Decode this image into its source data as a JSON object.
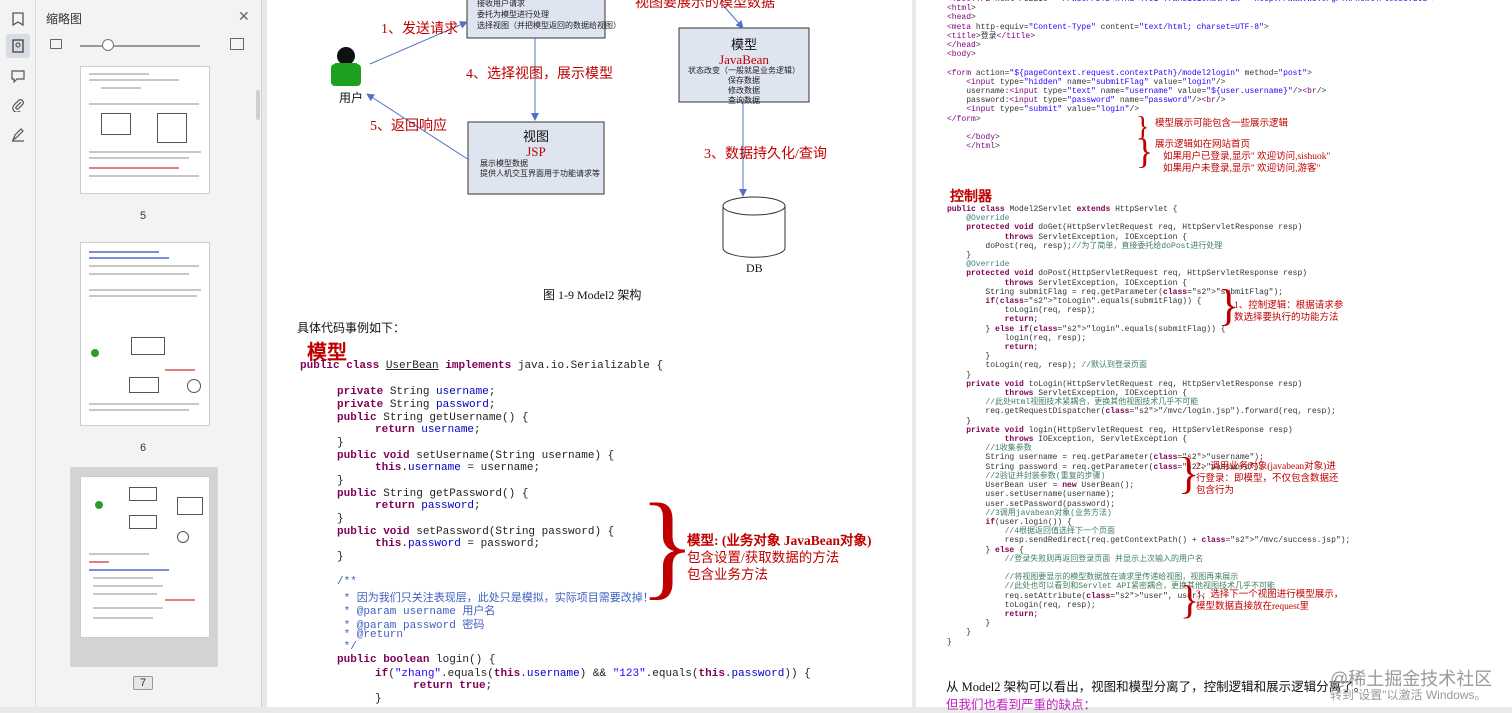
{
  "sidebar": {
    "title": "缩略图",
    "tools": [
      "bookmark-icon",
      "thumbnail-icon",
      "comment-icon",
      "attachment-icon",
      "signature-icon"
    ],
    "pages": [
      "5",
      "6",
      "7"
    ],
    "selected_page": "7"
  },
  "page1": {
    "diagram": {
      "step1": "1、发送请求",
      "step2_text": "视图要展示的模型数据",
      "step3": "3、数据持久化/查询",
      "step4": "4、选择视图，展示模型",
      "step5": "5、返回响应",
      "user_label": "用户",
      "controller_lines": [
        "接收用户请求",
        "委托为模型进行处理",
        "选择视图（并把模型返回的数据给视图）"
      ],
      "model_title": "模型",
      "model_sub": "JavaBean",
      "model_lines": [
        "状态改变（一般就是业务逻辑）",
        "保存数据",
        "修改数据",
        "查询数据"
      ],
      "view_title": "视图",
      "view_sub": "JSP",
      "view_lines": [
        "展示模型数据",
        "提供人机交互界面用于功能请求等"
      ],
      "db_label": "DB",
      "caption": "图 1-9 Model2 架构"
    },
    "intro": "具体代码事例如下：",
    "model_heading": "模型",
    "code_lines": [
      "public class UserBean implements java.io.Serializable {",
      "private String username;",
      "private String password;",
      "public String getUsername() {",
      "return username;",
      "}",
      "public void setUsername(String username) {",
      "this.username = username;",
      "}",
      "public String getPassword() {",
      "return password;",
      "}",
      "public void setPassword(String password) {",
      "this.password = password;",
      "}",
      "/**",
      " * 因为我们只关注表现层，此处只是模拟，实际项目需要改掉！",
      " * @param username 用户名",
      " * @param password 密码",
      " * @return",
      " */",
      "public boolean login() {",
      "if(\"zhang\".equals(this.username) && \"123\".equals(this.password)) {",
      "return true;",
      "}"
    ],
    "annotation": [
      "模型: (业务对象 JavaBean对象)",
      "包含设置/获取数据的方法",
      "包含业务方法"
    ]
  },
  "page2": {
    "html_lines": [
      "<!DOCTYPE html PUBLIC \"-//W3C//DTD HTML 4.01 Transitional//EN\" \"http://www.w3.org/TR/html4/loose.dtd\">",
      "<html>",
      "<head>",
      "<meta http-equiv=\"Content-Type\" content=\"text/html; charset=UTF-8\">",
      "<title>登录</title>",
      "</head>",
      "<body>",
      "",
      "<form action=\"${pageContext.request.contextPath}/model2login\" method=\"post\">",
      "    <input type=\"hidden\" name=\"submitFlag\" value=\"login\"/>",
      "    username:<input type=\"text\" name=\"username\" value=\"${user.username}\"/><br/>",
      "    password:<input type=\"password\" name=\"password\"/><br/>",
      "    <input type=\"submit\" value=\"login\"/>",
      "</form>",
      "",
      "    </body>",
      "    </html>"
    ],
    "view_note1": "模型展示可能包含一些展示逻辑",
    "view_note2": [
      "展示逻辑如在网站首页",
      "如果用户已登录,显示\" 欢迎访问,sishuok\"",
      "如果用户未登录,显示\" 欢迎访问,游客\""
    ],
    "controller_heading": "控制器",
    "servlet_lines": [
      "public class Model2Servlet extends HttpServlet {",
      "    @Override",
      "    protected void doGet(HttpServletRequest req, HttpServletResponse resp)",
      "            throws ServletException, IOException {",
      "        doPost(req, resp);//为了简单，直接委托给doPost进行处理",
      "    }",
      "    @Override",
      "    protected void doPost(HttpServletRequest req, HttpServletResponse resp)",
      "            throws ServletException, IOException {",
      "        String submitFlag = req.getParameter(\"submitFlag\");",
      "        if(\"toLogin\".equals(submitFlag)) {",
      "            toLogin(req, resp);",
      "            return;",
      "        } else if(\"login\".equals(submitFlag)) {",
      "            login(req, resp);",
      "            return;",
      "        }",
      "        toLogin(req, resp); //默认到登录页面",
      "    }",
      "    private void toLogin(HttpServletRequest req, HttpServletResponse resp)",
      "            throws ServletException, IOException {",
      "        //此处Html视图技术紧耦合，更换其他视图技术几乎不可能",
      "        req.getRequestDispatcher(\"/mvc/login.jsp\").forward(req, resp);",
      "    }",
      "    private void login(HttpServletRequest req, HttpServletResponse resp)",
      "            throws IOException, ServletException {",
      "        //1收集参数",
      "        String username = req.getParameter(\"username\");",
      "        String password = req.getParameter(\"password\");",
      "        //2验证并封装参数(重复的步骤)",
      "        UserBean user = new UserBean();",
      "        user.setUsername(username);",
      "        user.setPassword(password);",
      "        //3调用javabean对象(业务方法)",
      "        if(user.login()) {",
      "            //4根据返回值选择下一个页面",
      "            resp.sendRedirect(req.getContextPath() + \"/mvc/success.jsp\");",
      "        } else {",
      "            //登录失败则再返回登录页面 并显示上次输入的用户名",
      "",
      "            //将视图要显示的模型数据放在请求里传递给视图，视图再来展示",
      "            //此处也可以看到和Servlet API紧密耦合，更换其他视图技术几乎不可能",
      "            req.setAttribute(\"user\", user);",
      "            toLogin(req, resp);",
      "            return;",
      "        }",
      "    }",
      "}"
    ],
    "note1": [
      "1、控制逻辑：根据请求参",
      "数选择要执行的功能方法"
    ],
    "note2": [
      "2、调用业务对象(javabean对象)进",
      "行登录：即模型，不仅包含数据还",
      "包含行为"
    ],
    "note3": [
      "3、选择下一个视图进行模型展示，",
      "模型数据直接放在request里"
    ],
    "summary": "从 Model2 架构可以看出，视图和模型分离了，控制逻辑和展示逻辑分离了。",
    "bad_point": "但我们也看到严重的缺点："
  },
  "watermark": {
    "line1": "@稀土掘金技术社区",
    "line2": "转到\"设置\"以激活 Windows。"
  },
  "colors": {
    "accent_red": "#c00000",
    "keyword": "#7f0055",
    "field": "#0000c0",
    "string": "#2a00ff",
    "comment": "#3f7f5f"
  }
}
